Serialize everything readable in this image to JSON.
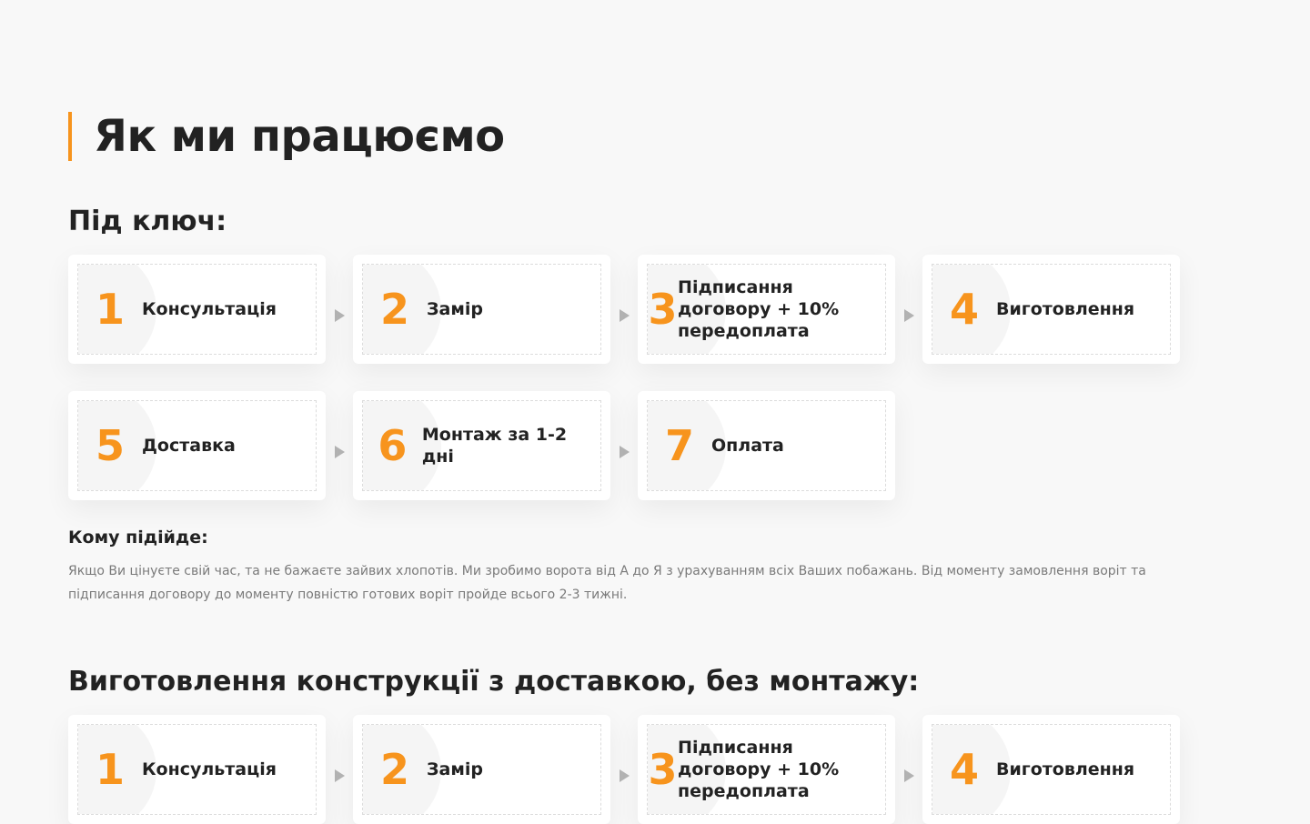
{
  "page": {
    "title": "Як ми працюємо"
  },
  "turnkey": {
    "title": "Під ключ:",
    "steps": [
      {
        "num": "1",
        "label": "Консультація"
      },
      {
        "num": "2",
        "label": "Замір"
      },
      {
        "num": "3",
        "label": "Підписання договору + 10% передоплата"
      },
      {
        "num": "4",
        "label": "Виготовлення"
      },
      {
        "num": "5",
        "label": "Доставка"
      },
      {
        "num": "6",
        "label": "Монтаж за 1-2 дні"
      },
      {
        "num": "7",
        "label": "Оплата"
      }
    ],
    "who_title": "Кому підійде:",
    "who_text": "Якщо Ви цінуєте свій час, та не бажаєте зайвих хлопотів. Ми зробимо ворота від А до Я з урахуванням всіх Ваших побажань. Від моменту замовлення воріт та підписання договору до моменту повністю готових воріт пройде всього 2-3 тижні."
  },
  "delivery": {
    "title": "Виготовлення конструкції з доставкою, без монтажу:",
    "steps": [
      {
        "num": "1",
        "label": "Консультація"
      },
      {
        "num": "2",
        "label": "Замір"
      },
      {
        "num": "3",
        "label": "Підписання договору + 10% передоплата"
      },
      {
        "num": "4",
        "label": "Виготовлення"
      }
    ]
  },
  "colors": {
    "accent": "#f7941d",
    "background": "#f8f8f8"
  }
}
